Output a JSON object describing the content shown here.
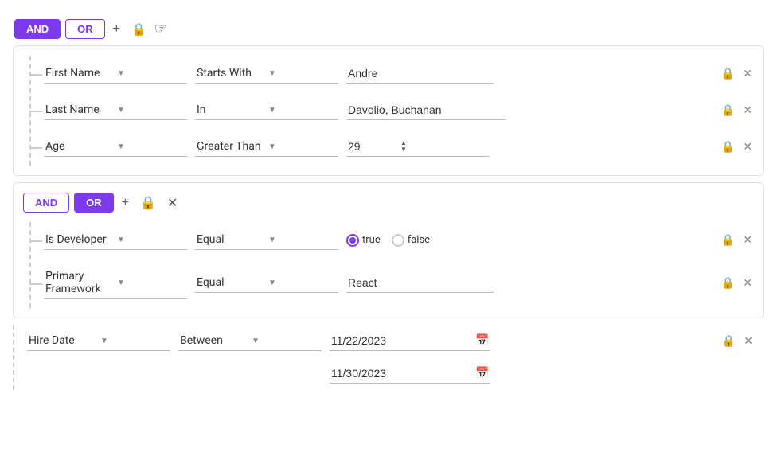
{
  "logic": {
    "and_label": "AND",
    "or_label": "OR",
    "add_icon": "+",
    "lock_unicode": "🔒",
    "close_unicode": "✕"
  },
  "nested_logic": {
    "and_label": "AND",
    "or_label": "OR",
    "add_icon": "+",
    "close_unicode": "✕"
  },
  "rows": [
    {
      "field": "First Name",
      "operator": "Starts With",
      "value": "Andre",
      "type": "text"
    },
    {
      "field": "Last Name",
      "operator": "In",
      "value": "Davolio, Buchanan",
      "type": "text"
    },
    {
      "field": "Age",
      "operator": "Greater Than",
      "value": "29",
      "type": "number"
    }
  ],
  "nested_rows": [
    {
      "field": "Is Developer",
      "operator": "Equal",
      "value_type": "boolean",
      "true_label": "true",
      "false_label": "false",
      "selected": "true"
    },
    {
      "field": "Primary Framework",
      "operator": "Equal",
      "value": "React",
      "type": "text"
    }
  ],
  "hire_date": {
    "field": "Hire Date",
    "operator": "Between",
    "date1": "11/22/2023",
    "date2": "11/30/2023"
  },
  "icons": {
    "lock": "🔒",
    "calendar": "📅",
    "chevron_down": "▼",
    "chevron_up": "▲",
    "plus": "+",
    "close": "✕"
  }
}
